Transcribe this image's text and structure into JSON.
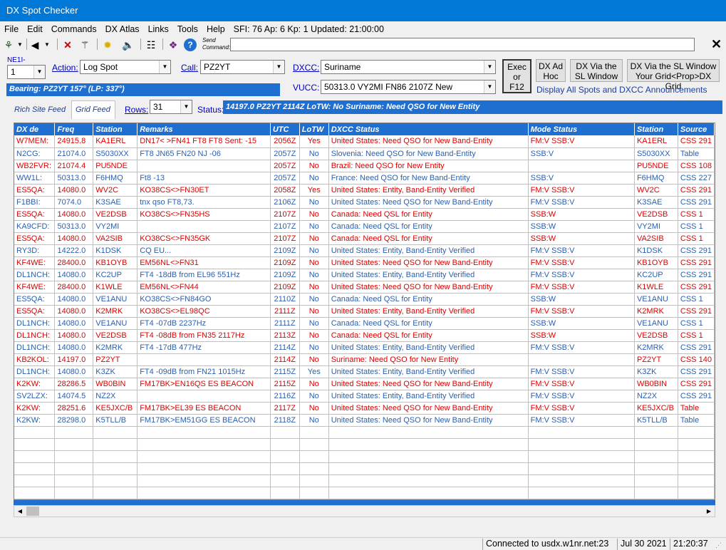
{
  "window": {
    "title": "DX Spot Checker"
  },
  "menu": [
    "File",
    "Edit",
    "Commands",
    "DX Atlas",
    "Links",
    "Tools",
    "Help"
  ],
  "menu_info": "SFI: 76 Ap: 6 Kp: 1 Updated: 21:00:00",
  "toolbar": {
    "send_label_1": "Send",
    "send_label_2": "Command:",
    "send_value": "",
    "close": "✕"
  },
  "controls": {
    "callsign_label": "NE1I-",
    "instance_value": "1",
    "action_label": "Action:",
    "action_value": "Log Spot",
    "call_label": "Call:",
    "call_value": "PZ2YT",
    "dxcc_label": "DXCC:",
    "dxcc_value": "Suriname",
    "vucc_label": "VUCC:",
    "vucc_value": "50313.0 VY2MI FN86 2107Z New",
    "exec_label_1": "Exec",
    "exec_label_2": "or",
    "exec_label_3": "F12",
    "adhoc_1": "DX Ad",
    "adhoc_2": "Hoc",
    "via_sl_1": "DX Via the",
    "via_sl_2": "SL Window",
    "via_sl_grid_1": "DX Via the SL Window",
    "via_sl_grid_2": "Your Grid<Prop>DX Grid",
    "display_all": "Display All Spots and DXCC Announcements",
    "bearing": "Bearing: PZ2YT 157° (LP: 337°)",
    "tab_rich": "Rich Site Feed",
    "tab_grid": "Grid Feed",
    "rows_label": "Rows:",
    "rows_value": "31",
    "status_label": "Status:",
    "status_value": "14197.0 PZ2YT 2114Z LoTW: No Suriname: Need QSO for New Entity"
  },
  "grid": {
    "headers": [
      "DX de",
      "Freq",
      "Station",
      "Remarks",
      "UTC",
      "LoTW",
      "DXCC Status",
      "Mode Status",
      "Station",
      "Source"
    ],
    "rows": [
      {
        "c": "red",
        "v": [
          "W7MEM:",
          "24915.8",
          "KA1ERL",
          "DN17< >FN41 FT8 FT8  Sent: -15",
          "2056Z",
          "Yes",
          "United States: Need QSO for New Band-Entity",
          "FM:V  SSB:V",
          "KA1ERL",
          "CSS 291"
        ]
      },
      {
        "c": "bl",
        "v": [
          "N2CG:",
          "21074.0",
          "S5030XX",
          "FT8 JN65 FN20 NJ -06",
          "2057Z",
          "No",
          "Slovenia: Need QSO for New Band-Entity",
          "SSB:V",
          "S5030XX",
          "Table"
        ]
      },
      {
        "c": "red",
        "v": [
          "WB2FVR:",
          "21074.4",
          "PU5NDE",
          "",
          "2057Z",
          "No",
          "Brazil: Need QSO for New Entity",
          "",
          "PU5NDE",
          "CSS 108"
        ]
      },
      {
        "c": "bl",
        "v": [
          "WW1L:",
          "50313.0",
          "F6HMQ",
          "Ft8 -13",
          "2057Z",
          "No",
          "France: Need QSO for New Band-Entity",
          "SSB:V",
          "F6HMQ",
          "CSS 227"
        ]
      },
      {
        "c": "red",
        "v": [
          "ES5QA:",
          "14080.0",
          "WV2C",
          "KO38CS<>FN30ET",
          "2058Z",
          "Yes",
          "United States: Entity, Band-Entity Verified",
          "FM:V  SSB:V",
          "WV2C",
          "CSS 291"
        ]
      },
      {
        "c": "bl",
        "v": [
          "F1BBI:",
          "7074.0",
          "K3SAE",
          "tnx qso FT8,73.",
          "2106Z",
          "No",
          "United States: Need QSO for New Band-Entity",
          "FM:V  SSB:V",
          "K3SAE",
          "CSS 291"
        ]
      },
      {
        "c": "red",
        "v": [
          "ES5QA:",
          "14080.0",
          "VE2DSB",
          "KO38CS<>FN35HS",
          "2107Z",
          "No",
          "Canada: Need QSL for Entity",
          "SSB:W",
          "VE2DSB",
          "CSS 1"
        ]
      },
      {
        "c": "bl",
        "v": [
          "KA9CFD:",
          "50313.0",
          "VY2MI",
          "",
          "2107Z",
          "No",
          "Canada: Need QSL for Entity",
          "SSB:W",
          "VY2MI",
          "CSS 1"
        ]
      },
      {
        "c": "red",
        "v": [
          "ES5QA:",
          "14080.0",
          "VA2SIB",
          "KO38CS<>FN35GK",
          "2107Z",
          "No",
          "Canada: Need QSL for Entity",
          "SSB:W",
          "VA2SIB",
          "CSS 1"
        ]
      },
      {
        "c": "bl",
        "v": [
          "RY3D:",
          "14222.0",
          "K1DSK",
          "CQ EU...",
          "2109Z",
          "No",
          "United States: Entity, Band-Entity Verified",
          "FM:V  SSB:V",
          "K1DSK",
          "CSS 291"
        ]
      },
      {
        "c": "red",
        "v": [
          "KF4WE:",
          "28400.0",
          "KB1OYB",
          "EM56NL<>FN31",
          "2109Z",
          "No",
          "United States: Need QSO for New Band-Entity",
          "FM:V  SSB:V",
          "KB1OYB",
          "CSS 291"
        ]
      },
      {
        "c": "bl",
        "v": [
          "DL1NCH:",
          "14080.0",
          "KC2UP",
          "FT4 -18dB from EL96 551Hz",
          "2109Z",
          "No",
          "United States: Entity, Band-Entity Verified",
          "FM:V  SSB:V",
          "KC2UP",
          "CSS 291"
        ]
      },
      {
        "c": "red",
        "v": [
          "KF4WE:",
          "28400.0",
          "K1WLE",
          "EM56NL<>FN44",
          "2109Z",
          "No",
          "United States: Need QSO for New Band-Entity",
          "FM:V  SSB:V",
          "K1WLE",
          "CSS 291"
        ]
      },
      {
        "c": "bl",
        "v": [
          "ES5QA:",
          "14080.0",
          "VE1ANU",
          "KO38CS<>FN84GO",
          "2110Z",
          "No",
          "Canada: Need QSL for Entity",
          "SSB:W",
          "VE1ANU",
          "CSS 1"
        ]
      },
      {
        "c": "red",
        "v": [
          "ES5QA:",
          "14080.0",
          "K2MRK",
          "KO38CS<>EL98QC",
          "2111Z",
          "No",
          "United States: Entity, Band-Entity Verified",
          "FM:V  SSB:V",
          "K2MRK",
          "CSS 291"
        ]
      },
      {
        "c": "bl",
        "v": [
          "DL1NCH:",
          "14080.0",
          "VE1ANU",
          "FT4 -07dB 2237Hz",
          "2111Z",
          "No",
          "Canada: Need QSL for Entity",
          "SSB:W",
          "VE1ANU",
          "CSS 1"
        ]
      },
      {
        "c": "red",
        "v": [
          "DL1NCH:",
          "14080.0",
          "VE2DSB",
          "FT4 -08dB from FN35 2117Hz",
          "2113Z",
          "No",
          "Canada: Need QSL for Entity",
          "SSB:W",
          "VE2DSB",
          "CSS 1"
        ]
      },
      {
        "c": "bl",
        "v": [
          "DL1NCH:",
          "14080.0",
          "K2MRK",
          "FT4 -17dB 477Hz",
          "2114Z",
          "No",
          "United States: Entity, Band-Entity Verified",
          "FM:V  SSB:V",
          "K2MRK",
          "CSS 291"
        ]
      },
      {
        "c": "red",
        "v": [
          "KB2KOL:",
          "14197.0",
          "PZ2YT",
          "",
          "2114Z",
          "No",
          "Suriname: Need QSO for New Entity",
          "",
          "PZ2YT",
          "CSS 140"
        ]
      },
      {
        "c": "bl",
        "v": [
          "DL1NCH:",
          "14080.0",
          "K3ZK",
          "FT4 -09dB from FN21 1015Hz",
          "2115Z",
          "Yes",
          "United States: Entity, Band-Entity Verified",
          "FM:V  SSB:V",
          "K3ZK",
          "CSS 291"
        ]
      },
      {
        "c": "red",
        "v": [
          "K2KW:",
          "28286.5",
          "WB0BIN",
          "FM17BK>EN16QS ES BEACON",
          "2115Z",
          "No",
          "United States: Need QSO for New Band-Entity",
          "FM:V  SSB:V",
          "WB0BIN",
          "CSS 291"
        ]
      },
      {
        "c": "bl",
        "v": [
          "SV2LZX:",
          "14074.5",
          "NZ2X",
          "",
          "2116Z",
          "No",
          "United States: Entity, Band-Entity Verified",
          "FM:V  SSB:V",
          "NZ2X",
          "CSS 291"
        ]
      },
      {
        "c": "red",
        "v": [
          "K2KW:",
          "28251.6",
          "KE5JXC/B",
          "FM17BK>EL39 ES BEACON",
          "2117Z",
          "No",
          "United States: Need QSO for New Band-Entity",
          "FM:V  SSB:V",
          "KE5JXC/B",
          "Table"
        ]
      },
      {
        "c": "bl",
        "v": [
          "K2KW:",
          "28298.0",
          "K5TLL/B",
          "FM17BK>EM51GG ES BEACON",
          "2118Z",
          "No",
          "United States: Need QSO for New Band-Entity",
          "FM:V  SSB:V",
          "K5TLL/B",
          "Table"
        ]
      }
    ],
    "empty_rows": 6
  },
  "statusbar": {
    "connection": "Connected to usdx.w1nr.net:23",
    "date": "Jul 30 2021",
    "time": "21:20:37"
  }
}
